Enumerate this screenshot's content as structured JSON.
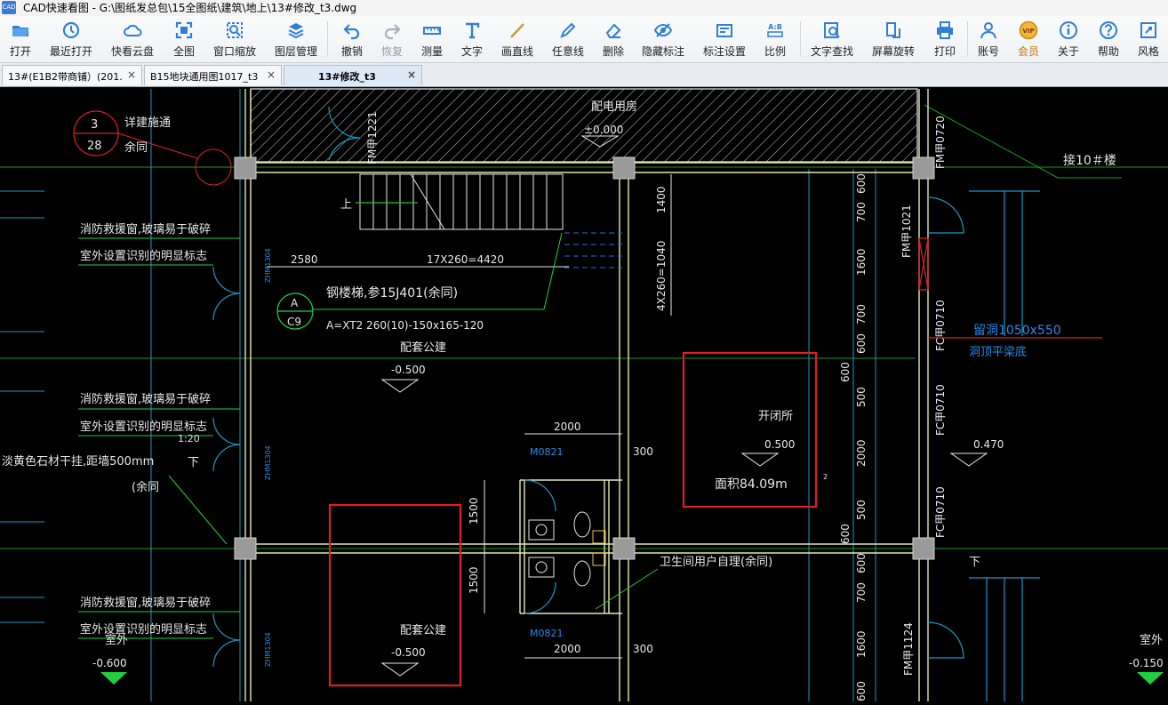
{
  "window": {
    "title": "CAD快速看图 - G:\\图纸发总包\\15全图纸\\建筑\\地上\\13#修改_t3.dwg",
    "app_icon_text": "CAD"
  },
  "toolbar": {
    "open": "打开",
    "recent": "最近打开",
    "cloud": "快看云盘",
    "fit": "全图",
    "window_zoom": "窗口缩放",
    "layers": "图层管理",
    "undo": "撤销",
    "redo": "恢复",
    "measure": "测量",
    "text": "文字",
    "line": "画直线",
    "freeline": "任意线",
    "delete": "删除",
    "hide_annot": "隐藏标注",
    "annot_settings": "标注设置",
    "scale": "比例",
    "scale_icon_text": "A:B",
    "find_text": "文字查找",
    "rotate": "屏幕旋转",
    "print": "打印",
    "account": "账号",
    "vip": "会员",
    "vip_icon_text": "VIP",
    "about": "关于",
    "help": "帮助",
    "style": "风格"
  },
  "tabs": [
    {
      "label": "13#(E1B2带商铺）(201…",
      "close": "×"
    },
    {
      "label": "B15地块通用图1017_t3",
      "close": "×"
    },
    {
      "label": "13#修改_t3",
      "close": "×"
    }
  ],
  "drawing": {
    "labels": {
      "room_power": "配电用房",
      "elev_power": "±0.000",
      "door_fm1221": "FM甲1221",
      "door_fm0720": "FM甲0720",
      "to_building": "接10＃楼",
      "detail_num": "3",
      "detail_sheet": "28",
      "detail_text1": "详建施通",
      "detail_text2": "余同",
      "up": "上",
      "dim_1400": "1400",
      "dim_4x260": "4X260=1040",
      "dim_2580": "2580",
      "dim_17x260": "17X260=4420",
      "rescue1a": "消防救援窗,玻璃易于破碎",
      "rescue1b": "室外设置识别的明显标志",
      "rescue2a": "消防救援窗,玻璃易于破碎",
      "rescue2b": "室外设置识别的明显标志",
      "rescue3a": "消防救援窗,玻璃易于破碎",
      "rescue3b": "室外设置识别的明显标志",
      "stair_ref": "钢楼梯,参15J401(余同)",
      "stair_spec": "A=XT2 260(10)-150x165-120",
      "sec_letter": "A",
      "sec_sheet": "C9",
      "room_support1": "配套公建",
      "elev_support1": "-0.500",
      "room_support2": "配套公建",
      "elev_support2": "-0.500",
      "room_switch": "开闭所",
      "elev_switch": "0.500",
      "area_switch": "面积84.09m",
      "area_sup": "2",
      "hole": "留洞1050x550",
      "hole_note": "洞顶平梁底",
      "door_fm1021": "FM甲1021",
      "door_fc0710a": "FC甲0710",
      "door_fc0710b": "FC甲0710",
      "door_fc0710c": "FC甲0710",
      "door_fm1124": "FM甲1124",
      "elev_470": "0.470",
      "slope": "1:20",
      "down1": "下",
      "down2": "下",
      "stone1": "淡黄色石材干挂,距墙500mm",
      "stone2": "(余同",
      "dim_2000a": "2000",
      "dim_2000b": "2000",
      "dim_300a": "300",
      "dim_300b": "300",
      "dim_1500a": "1500",
      "dim_1500b": "1500",
      "m0821a": "M0821",
      "m0821b": "M0821",
      "toilet_note": "卫生间用户自理(余同)",
      "outdoor_left": "室外",
      "elev_left": "-0.600",
      "outdoor_right": "室外",
      "elev_right": "-0.150",
      "win_a": "ZHM1304",
      "win_b": "ZHM1304",
      "win_c": "ZHM1304",
      "dim_600a": "600",
      "dim_700a": "700",
      "dim_1600a": "1600",
      "dim_700b": "700",
      "dim_600b": "600",
      "dim_600c": "600",
      "dim_500a": "500",
      "dim_2000c": "2000",
      "dim_500b": "500",
      "dim_600d": "600",
      "dim_600e": "600",
      "dim_700c": "700",
      "dim_1600b": "1600",
      "dim_600f": "600"
    }
  }
}
